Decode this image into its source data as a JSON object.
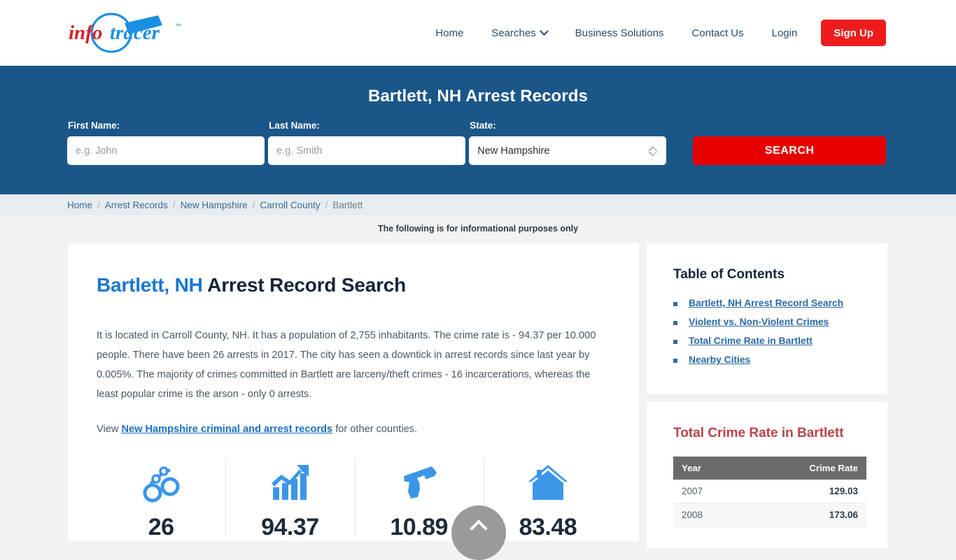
{
  "brand": {
    "logo_info": "info",
    "logo_tracer": "tracer",
    "logo_tm": "™",
    "accent_red": "#ed1c1c",
    "accent_blue": "#1b5689",
    "icon_blue": "#3b96e8"
  },
  "nav": {
    "items": [
      {
        "label": "Home",
        "icon": ""
      },
      {
        "label": "Searches",
        "icon": "chevron-down-icon"
      },
      {
        "label": "Business Solutions",
        "icon": ""
      },
      {
        "label": "Contact Us",
        "icon": ""
      },
      {
        "label": "Login",
        "icon": ""
      }
    ],
    "signup_label": "Sign Up"
  },
  "hero": {
    "title": "Bartlett, NH Arrest Records",
    "first_name_label": "First Name:",
    "first_name_placeholder": "e.g. John",
    "first_name_value": "",
    "last_name_label": "Last Name:",
    "last_name_placeholder": "e.g. Smith",
    "last_name_value": "",
    "state_label": "State:",
    "state_value": "New Hampshire",
    "state_options": [
      "New Hampshire"
    ],
    "search_label": "SEARCH"
  },
  "breadcrumb": {
    "items": [
      "Home",
      "Arrest Records",
      "New Hampshire",
      "Carroll County",
      "Bartlett"
    ],
    "separator": "/"
  },
  "info_note": "The following is for informational purposes only",
  "main": {
    "heading_city": "Bartlett",
    "heading_comma": ", ",
    "heading_state": "NH",
    "heading_rest": " Arrest Record Search",
    "paragraph": "It is located in Carroll County, NH. It has a population of 2,755 inhabitants. The crime rate is - 94.37 per 10.000 people. There have been 26 arrests in 2017. The city has seen a downtick in arrest records since last year by 0.005%. The majority of crimes committed in Bartlett are larceny/theft crimes - 16 incarcerations, whereas the least popular crime is the arson - only 0 arrests.",
    "view_prefix": "View ",
    "view_link": "New Hampshire criminal and arrest records",
    "view_suffix": " for other counties.",
    "stats": [
      {
        "icon": "handcuffs-icon",
        "value": "26"
      },
      {
        "icon": "growth-chart-icon",
        "value": "94.37"
      },
      {
        "icon": "handgun-icon",
        "value": "10.89"
      },
      {
        "icon": "house-icon",
        "value": "83.48"
      }
    ]
  },
  "sidebar": {
    "toc_title": "Table of Contents",
    "toc_items": [
      "Bartlett, NH Arrest Record Search",
      "Violent vs. Non-Violent Crimes",
      "Total Crime Rate in Bartlett",
      "Nearby Cities"
    ],
    "crime_title": "Total Crime Rate in Bartlett",
    "crime_headers": [
      "Year",
      "Crime Rate"
    ],
    "crime_rows": [
      {
        "year": "2007",
        "rate": "129.03"
      },
      {
        "year": "2008",
        "rate": "173.06"
      }
    ]
  },
  "scroll_top": {
    "icon": "chevron-up-icon",
    "label": ""
  }
}
